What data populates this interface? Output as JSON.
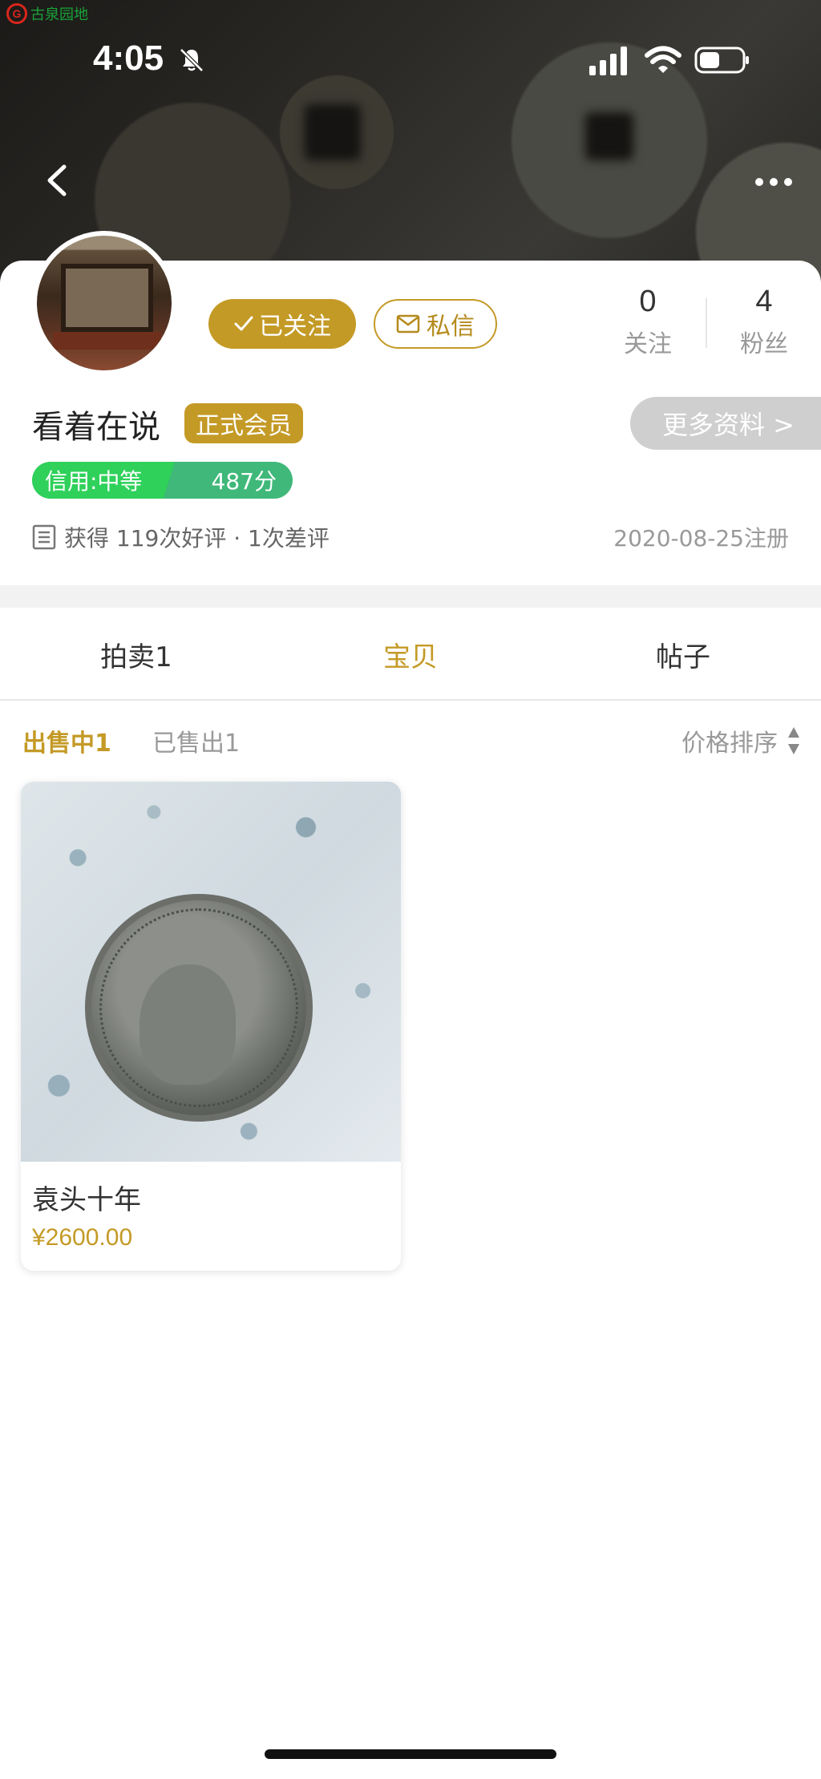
{
  "brand": {
    "logo_text": "G",
    "name": "古泉园地"
  },
  "status_bar": {
    "time": "4:05"
  },
  "profile": {
    "username": "看着在说",
    "member_badge": "正式会员",
    "follow_button": "已关注",
    "message_button": "私信",
    "following_count": "0",
    "following_label": "关注",
    "followers_count": "4",
    "followers_label": "粉丝",
    "more_info": "更多资料 >",
    "credit_label": "信用:中等",
    "credit_score": "487分",
    "reviews_text": "获得 119次好评 · 1次差评",
    "register_date": "2020-08-25注册"
  },
  "tabs": [
    {
      "label": "拍卖1",
      "active": false
    },
    {
      "label": "宝贝",
      "active": true
    },
    {
      "label": "帖子",
      "active": false
    }
  ],
  "filters": {
    "on_sale": "出售中1",
    "sold": "已售出1",
    "sort": "价格排序"
  },
  "products": [
    {
      "title": "袁头十年",
      "price": "¥2600.00"
    }
  ],
  "colors": {
    "accent": "#c49a26",
    "credit_green": "#3fb879",
    "credit_light": "#2fd15a"
  }
}
